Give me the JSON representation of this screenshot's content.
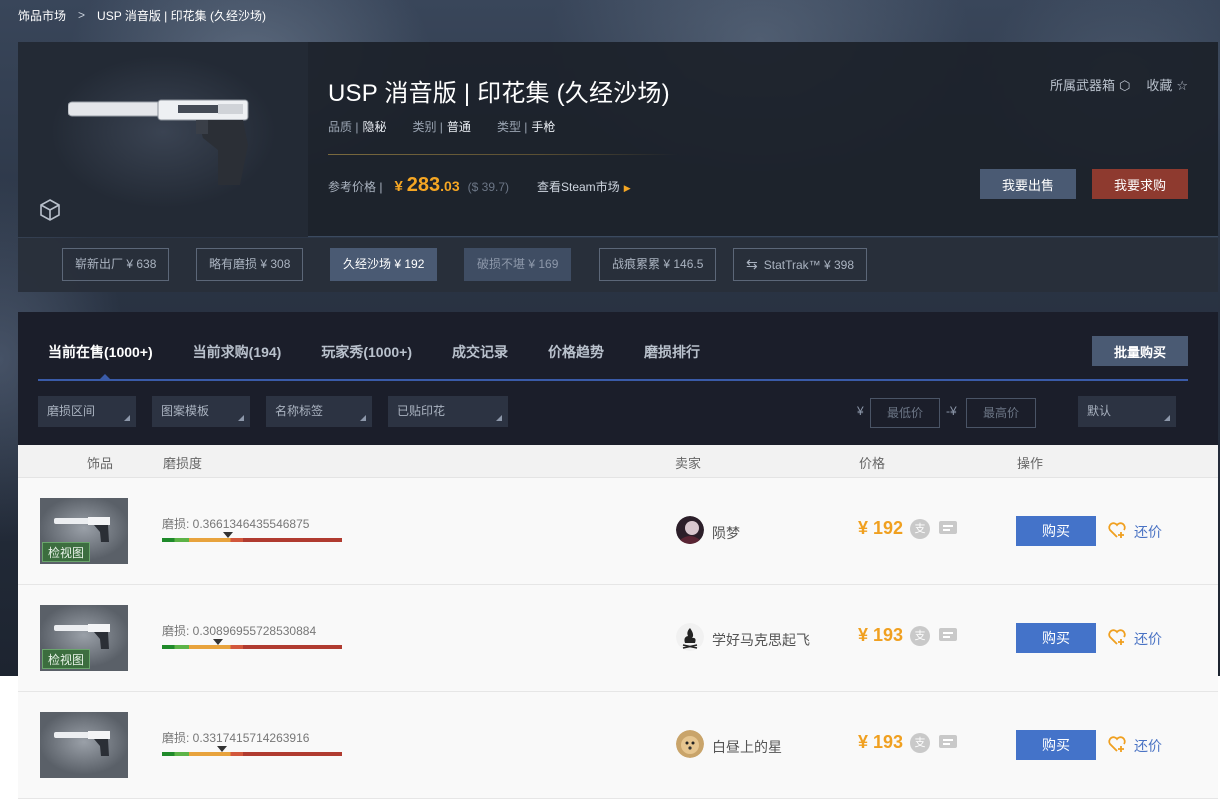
{
  "breadcrumb": [
    "饰品市场",
    "USP 消音版 | 印花集 (久经沙场)"
  ],
  "product": {
    "title": "USP 消音版 | 印花集 (久经沙场)",
    "attributes": [
      {
        "label": "品质 |",
        "value": "隐秘"
      },
      {
        "label": "类别 |",
        "value": "普通"
      },
      {
        "label": "类型 |",
        "value": "手枪"
      }
    ],
    "ref_price_label": "参考价格 |",
    "price_symbol": "¥",
    "price_int": "283",
    "price_dec": ".03",
    "price_usd": "($ 39.7)",
    "steam_link": "查看Steam市场",
    "weapon_case": "所属武器箱",
    "favorite": "收藏",
    "sell_button": "我要出售",
    "buy_button": "我要求购"
  },
  "wear_options": [
    {
      "label": "崭新出厂 ¥ 638",
      "state": "normal"
    },
    {
      "label": "略有磨损 ¥ 308",
      "state": "normal"
    },
    {
      "label": "久经沙场 ¥ 192",
      "state": "active"
    },
    {
      "label": "破损不堪 ¥ 169",
      "state": "dim"
    },
    {
      "label": "战痕累累 ¥ 146.5",
      "state": "normal"
    },
    {
      "label": "StatTrak™ ¥ 398",
      "state": "normal"
    }
  ],
  "tabs": [
    "当前在售(1000+)",
    "当前求购(194)",
    "玩家秀(1000+)",
    "成交记录",
    "价格趋势",
    "磨损排行"
  ],
  "bulk_buy": "批量购买",
  "filters": [
    "磨损区间",
    "图案模板",
    "名称标签",
    "已贴印花"
  ],
  "price_filter": {
    "yen": "¥",
    "sep": "-¥",
    "min_placeholder": "最低价",
    "max_placeholder": "最高价"
  },
  "sort": "默认",
  "table_headers": [
    "饰品",
    "磨损度",
    "卖家",
    "价格",
    "操作"
  ],
  "listings": [
    {
      "inspect": "检视图",
      "wear": "磨损: 0.3661346435546875",
      "wear_fraction": 0.366,
      "seller": "陨梦",
      "price": "¥ 192",
      "buy": "购买",
      "bargain": "还价"
    },
    {
      "inspect": "检视图",
      "wear": "磨损: 0.30896955728530884",
      "wear_fraction": 0.309,
      "seller": "学好马克思起飞",
      "price": "¥ 193",
      "buy": "购买",
      "bargain": "还价"
    },
    {
      "inspect": "",
      "wear": "磨损: 0.3317415714263916",
      "wear_fraction": 0.332,
      "seller": "白昼上的星",
      "price": "¥ 193",
      "buy": "购买",
      "bargain": "还价"
    }
  ],
  "row_icons": {
    "circle": "支",
    "message": "message-icon"
  },
  "colors": {
    "accent_blue": "#4473c9",
    "price_orange": "#f0a020",
    "sell_red": "#8e3a2f"
  }
}
